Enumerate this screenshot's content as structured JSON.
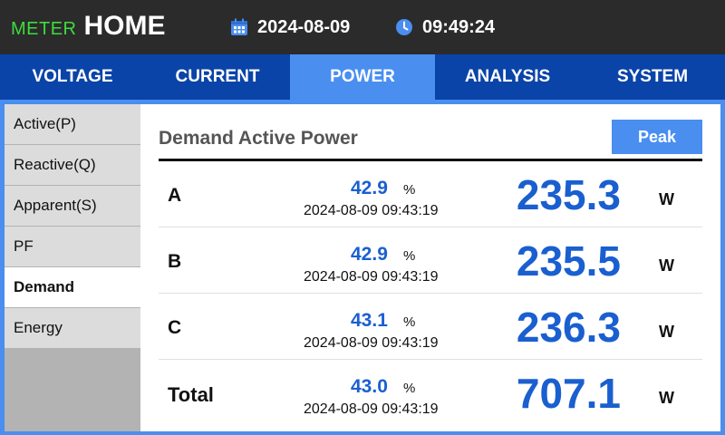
{
  "header": {
    "brand_meter": "METER",
    "brand_home": "HOME",
    "date": "2024-08-09",
    "time": "09:49:24",
    "date_icon": "calendar-icon",
    "time_icon": "clock-icon"
  },
  "tabs": [
    {
      "label": "VOLTAGE",
      "active": false
    },
    {
      "label": "CURRENT",
      "active": false
    },
    {
      "label": "POWER",
      "active": true
    },
    {
      "label": "ANALYSIS",
      "active": false
    },
    {
      "label": "SYSTEM",
      "active": false
    }
  ],
  "sidebar": {
    "items": [
      {
        "label": "Active(P)",
        "active": false
      },
      {
        "label": "Reactive(Q)",
        "active": false
      },
      {
        "label": "Apparent(S)",
        "active": false
      },
      {
        "label": "PF",
        "active": false
      },
      {
        "label": "Demand",
        "active": true
      },
      {
        "label": "Energy",
        "active": false
      }
    ]
  },
  "main": {
    "title": "Demand Active Power",
    "peak_label": "Peak",
    "rows": [
      {
        "label": "A",
        "percent": "42.9",
        "percent_unit": "%",
        "timestamp": "2024-08-09 09:43:19",
        "value": "235.3",
        "unit": "W"
      },
      {
        "label": "B",
        "percent": "42.9",
        "percent_unit": "%",
        "timestamp": "2024-08-09 09:43:19",
        "value": "235.5",
        "unit": "W"
      },
      {
        "label": "C",
        "percent": "43.1",
        "percent_unit": "%",
        "timestamp": "2024-08-09 09:43:19",
        "value": "236.3",
        "unit": "W"
      },
      {
        "label": "Total",
        "percent": "43.0",
        "percent_unit": "%",
        "timestamp": "2024-08-09 09:43:19",
        "value": "707.1",
        "unit": "W"
      }
    ]
  },
  "colors": {
    "header_bg": "#2b2b2b",
    "brand_green": "#3ddc3d",
    "tab_bar": "#0a44a8",
    "accent": "#4a8ef0",
    "value_blue": "#1a5fd0"
  }
}
